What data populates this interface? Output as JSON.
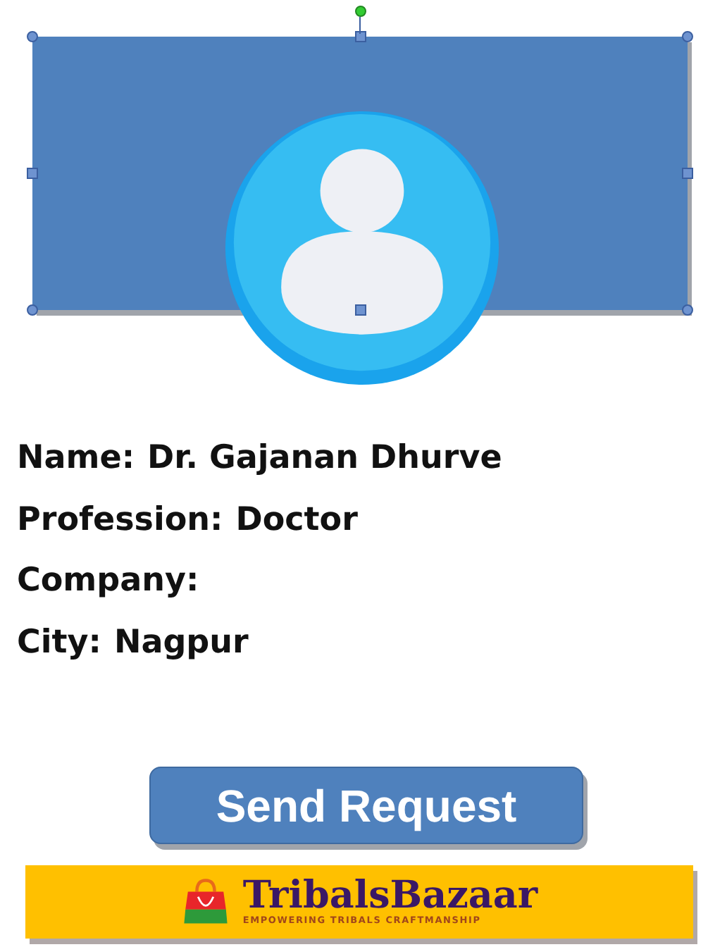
{
  "header_shape": {
    "selected": true
  },
  "fields": [
    {
      "label": "Name:",
      "value": "Dr. Gajanan Dhurve"
    },
    {
      "label": "Profession:",
      "value": "Doctor"
    },
    {
      "label": "Company:"
    },
    {
      "label": "City:",
      "value": "Nagpur"
    }
  ],
  "button": {
    "label": "Send Request"
  },
  "banner": {
    "brand": "TribalsBazaar",
    "tagline": "EMPOWERING TRIBALS CRAFTMANSHIP"
  }
}
